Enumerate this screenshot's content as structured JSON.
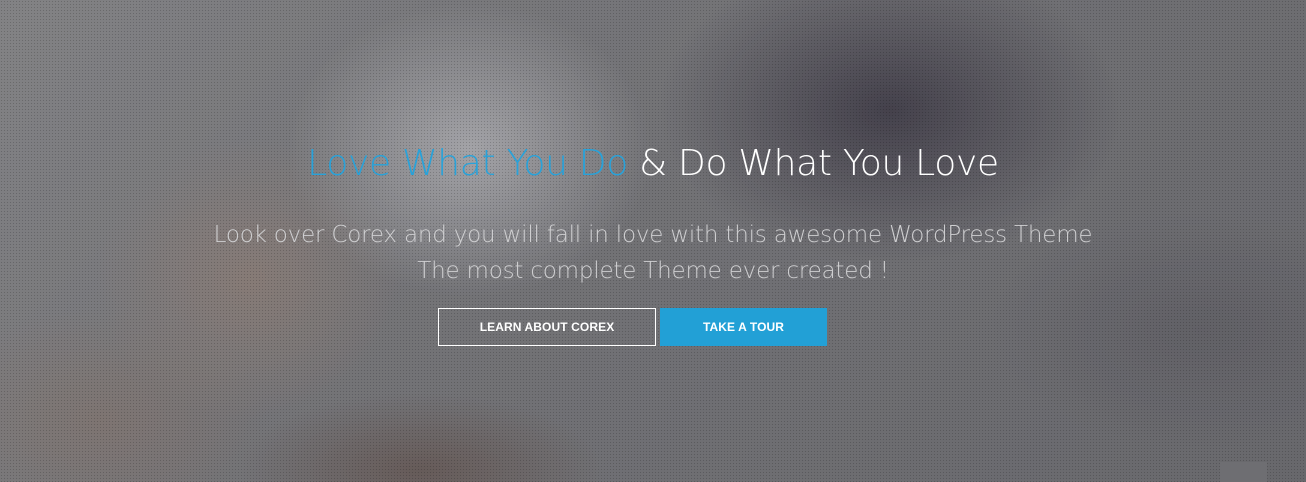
{
  "hero": {
    "headline_accent": "Love What You Do",
    "headline_rest": " & Do What You Love",
    "subline_1": "Look over Corex and you will fall in love with this awesome WordPress Theme",
    "subline_2": "The most complete Theme ever created !",
    "buttons": {
      "learn_label": "LEARN ABOUT COREX",
      "tour_label": "TAKE A TOUR"
    }
  },
  "colors": {
    "accent": "#29a2d9",
    "button_primary": "#22a0d6",
    "text_light": "#ffffff"
  }
}
